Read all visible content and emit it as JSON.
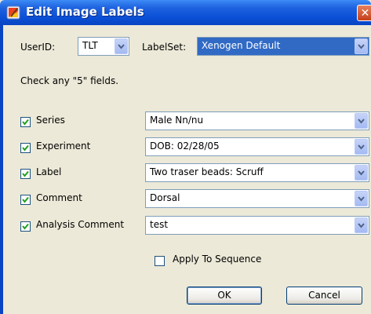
{
  "window": {
    "title": "Edit Image Labels"
  },
  "user": {
    "label": "UserID:",
    "value": "TLT"
  },
  "labelset": {
    "label": "LabelSet:",
    "value": "Xenogen Default"
  },
  "instruction": "Check any \"5\" fields.",
  "fields": [
    {
      "label": "Series",
      "value": "Male Nn/nu",
      "checked": true
    },
    {
      "label": "Experiment",
      "value": "DOB: 02/28/05",
      "checked": true
    },
    {
      "label": "Label",
      "value": "Two traser beads:  Scruff",
      "checked": true
    },
    {
      "label": "Comment",
      "value": "Dorsal",
      "checked": true
    },
    {
      "label": "Analysis Comment",
      "value": "test",
      "checked": true
    }
  ],
  "apply_sequence": {
    "label": "Apply To Sequence",
    "checked": false
  },
  "buttons": {
    "ok": "OK",
    "cancel": "Cancel"
  },
  "colors": {
    "titlebar": "#0A4FD6",
    "face": "#ECE9D8",
    "selection": "#316AC5"
  }
}
